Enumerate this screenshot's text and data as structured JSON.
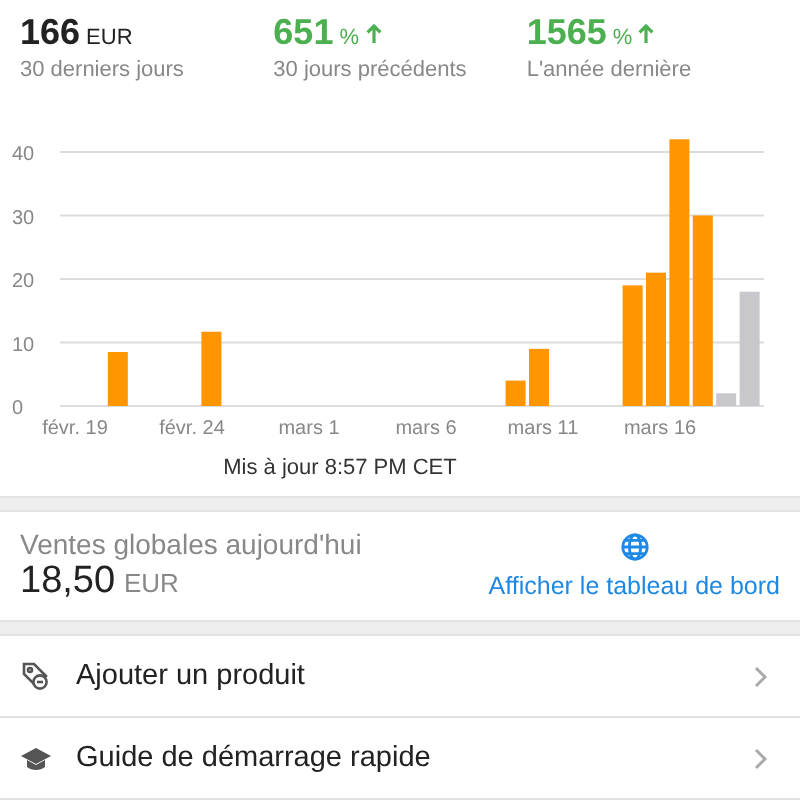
{
  "stats": [
    {
      "kind": "total",
      "value": "166",
      "unit": "EUR",
      "label": "30 derniers jours"
    },
    {
      "kind": "growth",
      "value": "651",
      "unit": "%",
      "label": "30 jours précédents"
    },
    {
      "kind": "growth",
      "value": "1565",
      "unit": "%",
      "label": "L'année dernière"
    }
  ],
  "chart_data": {
    "type": "bar",
    "stacked": true,
    "categories": [
      "févr. 19",
      null,
      null,
      null,
      null,
      "févr. 24",
      null,
      null,
      null,
      null,
      "mars 1",
      null,
      null,
      null,
      null,
      "mars 6",
      null,
      null,
      null,
      null,
      "mars 11",
      null,
      null,
      null,
      null,
      "mars 16",
      null,
      null,
      null,
      null
    ],
    "series": [
      {
        "color": "#ff9500",
        "values": [
          null,
          null,
          8.5,
          null,
          null,
          null,
          11.7,
          null,
          null,
          null,
          null,
          null,
          null,
          null,
          null,
          null,
          null,
          null,
          null,
          4,
          9,
          null,
          null,
          null,
          19,
          21,
          42,
          30,
          null,
          null
        ]
      },
      {
        "color": "#c7c7cc",
        "values": [
          null,
          null,
          null,
          null,
          null,
          null,
          null,
          null,
          null,
          null,
          null,
          null,
          null,
          null,
          null,
          null,
          null,
          null,
          null,
          null,
          null,
          null,
          null,
          null,
          null,
          null,
          null,
          null,
          2,
          18
        ]
      }
    ],
    "ylim": [
      0,
      42
    ],
    "yticks": [
      0,
      10,
      20,
      30,
      40
    ],
    "grid": true
  },
  "updated": "Mis à jour 8:57 PM CET",
  "today": {
    "label": "Ventes globales aujourd'hui",
    "value": "18,50",
    "unit": "EUR",
    "link": "Afficher le tableau de bord"
  },
  "menu": [
    {
      "kind": "product",
      "label": "Ajouter un produit"
    },
    {
      "kind": "guide",
      "label": "Guide de démarrage rapide"
    }
  ]
}
